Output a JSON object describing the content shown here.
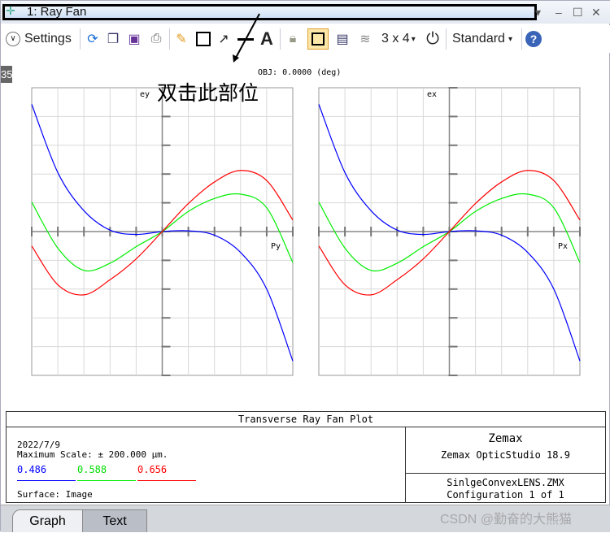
{
  "window": {
    "title": "1: Ray Fan",
    "controls": [
      "▾",
      "–",
      "☐",
      "✕"
    ]
  },
  "toolbar": {
    "settings_label": "Settings",
    "layout_label": "3 x 4",
    "layout_arrow": "▾",
    "style_label": "Standard",
    "style_arrow": "▾",
    "icons": [
      "refresh-icon",
      "copy-icon",
      "save-icon",
      "print-icon",
      "pencil-icon",
      "rectangle-icon",
      "arrow-icon",
      "line-icon",
      "text-icon",
      "lock-icon",
      "fit-icon",
      "window-icon",
      "layers-icon",
      "power-icon",
      "help-icon"
    ]
  },
  "side_badge": "35",
  "annotation": "双击此部位",
  "plot_header": "OBJ: 0.0000 (deg)",
  "chart_data": [
    {
      "type": "line",
      "xlabel": "Py",
      "ylabel": "ey",
      "xlim": [
        -1,
        1
      ],
      "ylim": [
        -200,
        200
      ],
      "grid": true,
      "x": [
        -1,
        -0.8,
        -0.6,
        -0.4,
        -0.2,
        0,
        0.2,
        0.4,
        0.6,
        0.8,
        1
      ],
      "series": [
        {
          "color": "#0000ff",
          "values": [
            177,
            82,
            29,
            2,
            -4,
            0,
            1,
            -5,
            -29,
            -80,
            -180
          ]
        },
        {
          "color": "#00ee00",
          "values": [
            41,
            -23,
            -54,
            -44,
            -21,
            0,
            28,
            46,
            52,
            33,
            -43
          ]
        },
        {
          "color": "#ff0000",
          "values": [
            -20,
            -74,
            -88,
            -67,
            -38,
            0,
            39,
            69,
            85,
            71,
            16
          ]
        }
      ]
    },
    {
      "type": "line",
      "xlabel": "Px",
      "ylabel": "ex",
      "xlim": [
        -1,
        1
      ],
      "ylim": [
        -200,
        200
      ],
      "grid": true,
      "x": [
        -1,
        -0.8,
        -0.6,
        -0.4,
        -0.2,
        0,
        0.2,
        0.4,
        0.6,
        0.8,
        1
      ],
      "series": [
        {
          "color": "#0000ff",
          "values": [
            177,
            82,
            29,
            2,
            -4,
            0,
            1,
            -5,
            -29,
            -80,
            -180
          ]
        },
        {
          "color": "#00ee00",
          "values": [
            41,
            -23,
            -54,
            -44,
            -21,
            0,
            28,
            46,
            52,
            33,
            -43
          ]
        },
        {
          "color": "#ff0000",
          "values": [
            -20,
            -74,
            -88,
            -67,
            -38,
            0,
            39,
            69,
            85,
            71,
            16
          ]
        }
      ]
    }
  ],
  "info": {
    "title": "Transverse Ray Fan Plot",
    "date": "2022/7/9",
    "scale": "Maximum Scale: ± 200.000 µm.",
    "wavelengths": [
      {
        "label": "0.486",
        "color": "#0000ff"
      },
      {
        "label": "0.588",
        "color": "#00ee00"
      },
      {
        "label": "0.656",
        "color": "#ff0000"
      }
    ],
    "surface": "Surface: Image",
    "company": "Zemax",
    "product": "Zemax OpticStudio 18.9",
    "file": "SinlgeConvexLENS.ZMX",
    "config": "Configuration 1 of 1"
  },
  "tabs": [
    {
      "label": "Graph",
      "active": true
    },
    {
      "label": "Text",
      "active": false
    }
  ],
  "watermark": "CSDN @勤奋的大熊猫"
}
